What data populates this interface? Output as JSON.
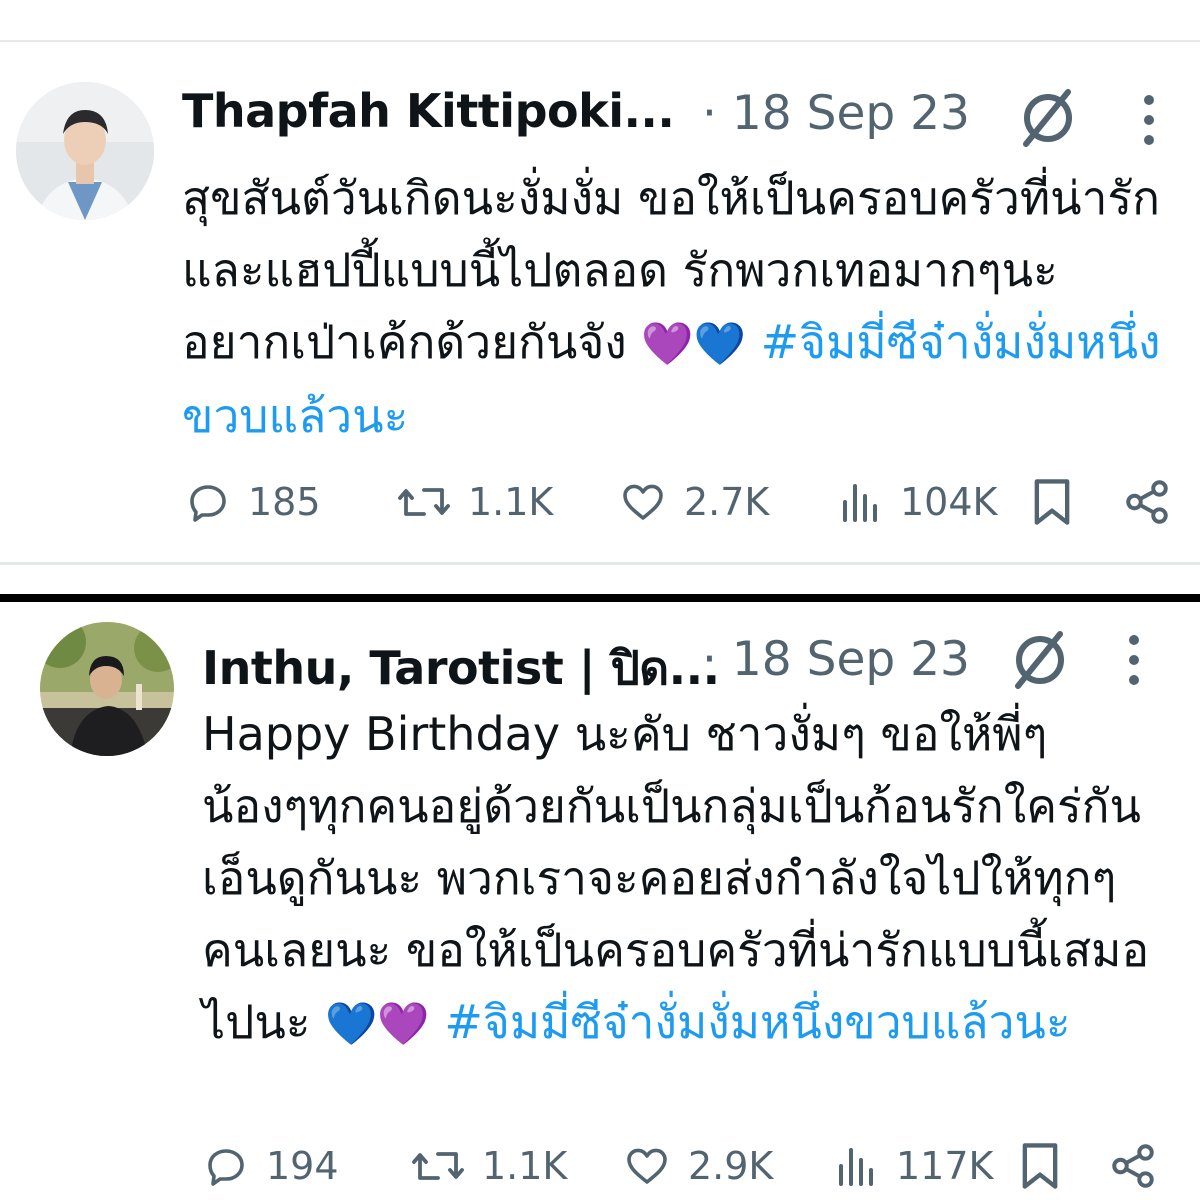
{
  "tweets": [
    {
      "author_name": "Thapfah Kittipoki...",
      "date": "· 18 Sep 23",
      "text": "สุขสันต์วันเกิดนะงั่มงั่ม ขอให้เป็นครอบครัวที่น่ารักและแฮปปี้แบบนี้ไปตลอด รักพวกเทอมากๆนะ อยากเป่าเค้กด้วยกันจัง",
      "emojis": "💜💙",
      "hashtag": "#จิมมี่ซีจ๋างั่มงั่มหนึ่งขวบแล้วนะ",
      "replies": "185",
      "reposts": "1.1K",
      "likes": "2.7K",
      "views": "104K"
    },
    {
      "author_name": "Inthu, Tarotist | ปิด...",
      "date": "· 18 Sep 23",
      "text": "Happy Birthday นะคับ ชาวงั่มๆ ขอให้พี่ๆน้องๆทุกคนอยู่ด้วยกันเป็นกลุ่มเป็นก้อนรักใคร่กันเอ็นดูกันนะ พวกเราจะคอยส่งกำลังใจไปให้ทุกๆคนเลยนะ ขอให้เป็นครอบครัวที่น่ารักแบบนี้เสมอไปนะ",
      "emojis": "💙💜",
      "hashtag": "#จิมมี่ซีจ๋างั่มงั่มหนึ่งขวบแล้วนะ",
      "replies": "194",
      "reposts": "1.1K",
      "likes": "2.9K",
      "views": "117K"
    }
  ],
  "icons": [
    "grok-icon",
    "more-icon",
    "reply-icon",
    "repost-icon",
    "like-icon",
    "views-icon",
    "bookmark-icon",
    "share-icon"
  ],
  "colors": {
    "hashtag": "#1d9bf0",
    "secondary_text": "#536471",
    "primary_text": "#0f1419",
    "emoji_purple": "#9b59d0",
    "emoji_blue": "#1e88e5"
  }
}
